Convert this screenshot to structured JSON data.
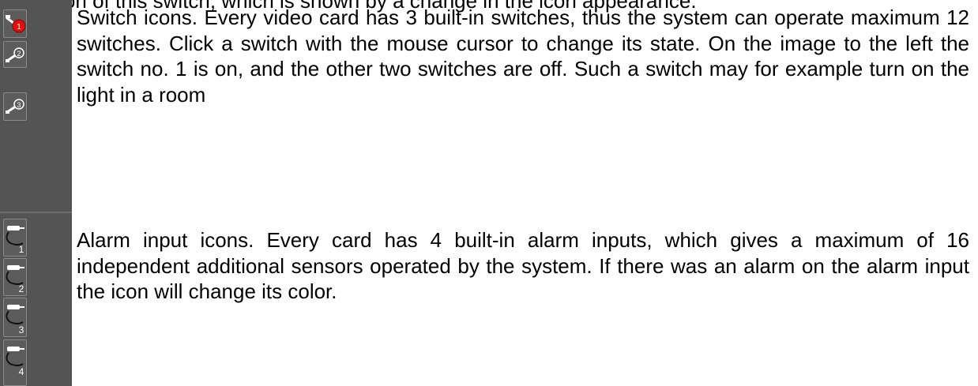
{
  "header": {
    "partial_line": "activation of this switch, which is shown by a change in the icon appearance."
  },
  "switch_section": {
    "description": "Switch icons. Every video card has 3 built-in switches, thus the system can operate maximum 12 switches. Click a switch with the mouse cursor to change its state. On the image to the left the switch no. 1 is on, and the other two switches are off. Such a switch may for example turn on the light in a room",
    "switches": [
      {
        "number": "1",
        "state": "on",
        "color": "#e01010"
      },
      {
        "number": "2",
        "state": "off",
        "color": "#ffffff"
      },
      {
        "number": "3",
        "state": "off",
        "color": "#ffffff"
      }
    ]
  },
  "alarm_section": {
    "description": "Alarm input icons. Every card has 4 built-in alarm inputs, which gives a maximum of 16 independent additional sensors operated by the system. If there was an alarm on the alarm input the icon will change its color.",
    "inputs": [
      {
        "number": "1"
      },
      {
        "number": "2"
      },
      {
        "number": "3"
      },
      {
        "number": "4"
      }
    ]
  }
}
